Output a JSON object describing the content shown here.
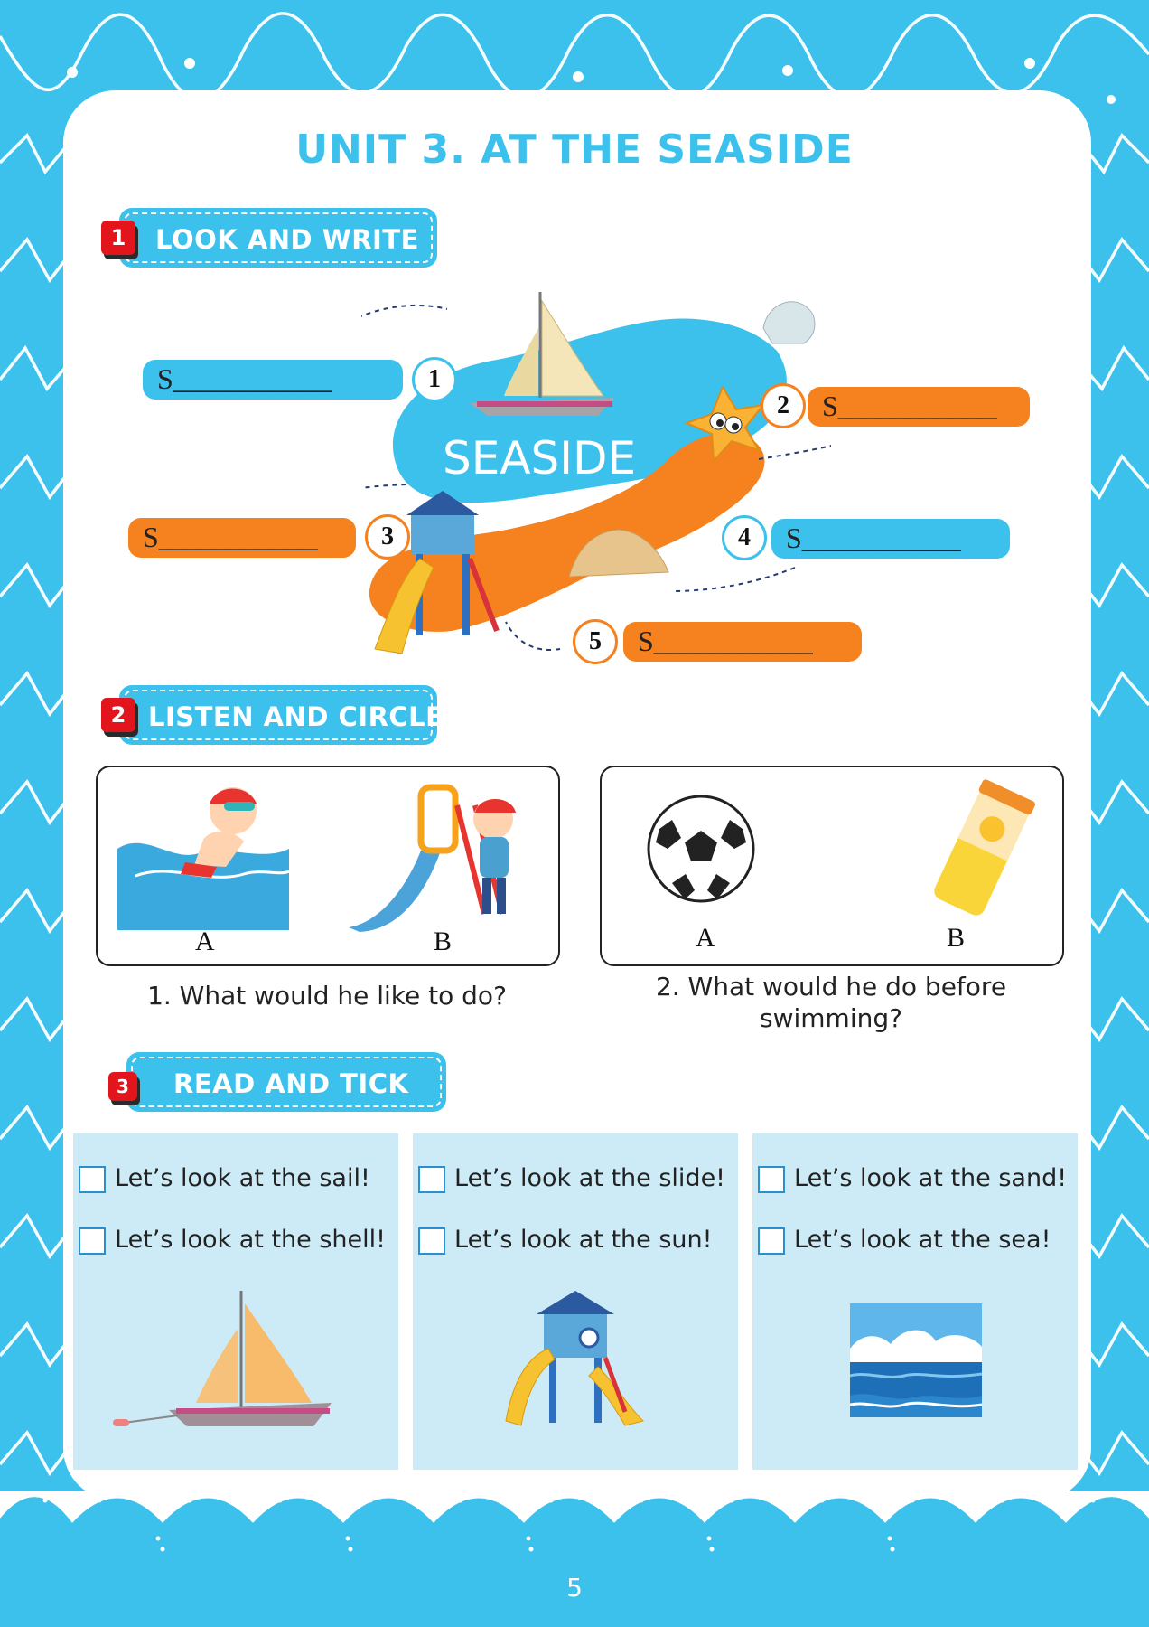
{
  "title": "UNIT 3. AT THE SEASIDE",
  "colors": {
    "accent_blue": "#3cc1ec",
    "accent_orange": "#f5821f",
    "badge_red": "#e2141c",
    "panel_blue": "#cdebf7"
  },
  "sections": [
    {
      "number": "1",
      "label": "LOOK AND WRITE"
    },
    {
      "number": "2",
      "label": "LISTEN AND CIRCLE"
    },
    {
      "number": "3",
      "label": "READ AND TICK"
    }
  ],
  "look_and_write": {
    "center_word": "SEASIDE",
    "items": [
      {
        "number": "1",
        "prompt": "S___________"
      },
      {
        "number": "2",
        "prompt": "S___________"
      },
      {
        "number": "3",
        "prompt": "S___________"
      },
      {
        "number": "4",
        "prompt": "S___________"
      },
      {
        "number": "5",
        "prompt": "S___________"
      }
    ]
  },
  "listen_and_circle": {
    "questions": [
      {
        "text": "1. What would he like to do?",
        "options": [
          "A",
          "B"
        ]
      },
      {
        "text": "2. What would he do before swimming?",
        "options": [
          "A",
          "B"
        ]
      }
    ]
  },
  "read_and_tick": {
    "panels": [
      {
        "options": [
          "Let’s look at the sail!",
          "Let’s look at the shell!"
        ],
        "picture": "sailboat"
      },
      {
        "options": [
          "Let’s look at the slide!",
          "Let’s look at the sun!"
        ],
        "picture": "playground-slide"
      },
      {
        "options": [
          "Let’s look at the sand!",
          "Let’s look at the sea!"
        ],
        "picture": "sea"
      }
    ]
  },
  "page_number": "5"
}
